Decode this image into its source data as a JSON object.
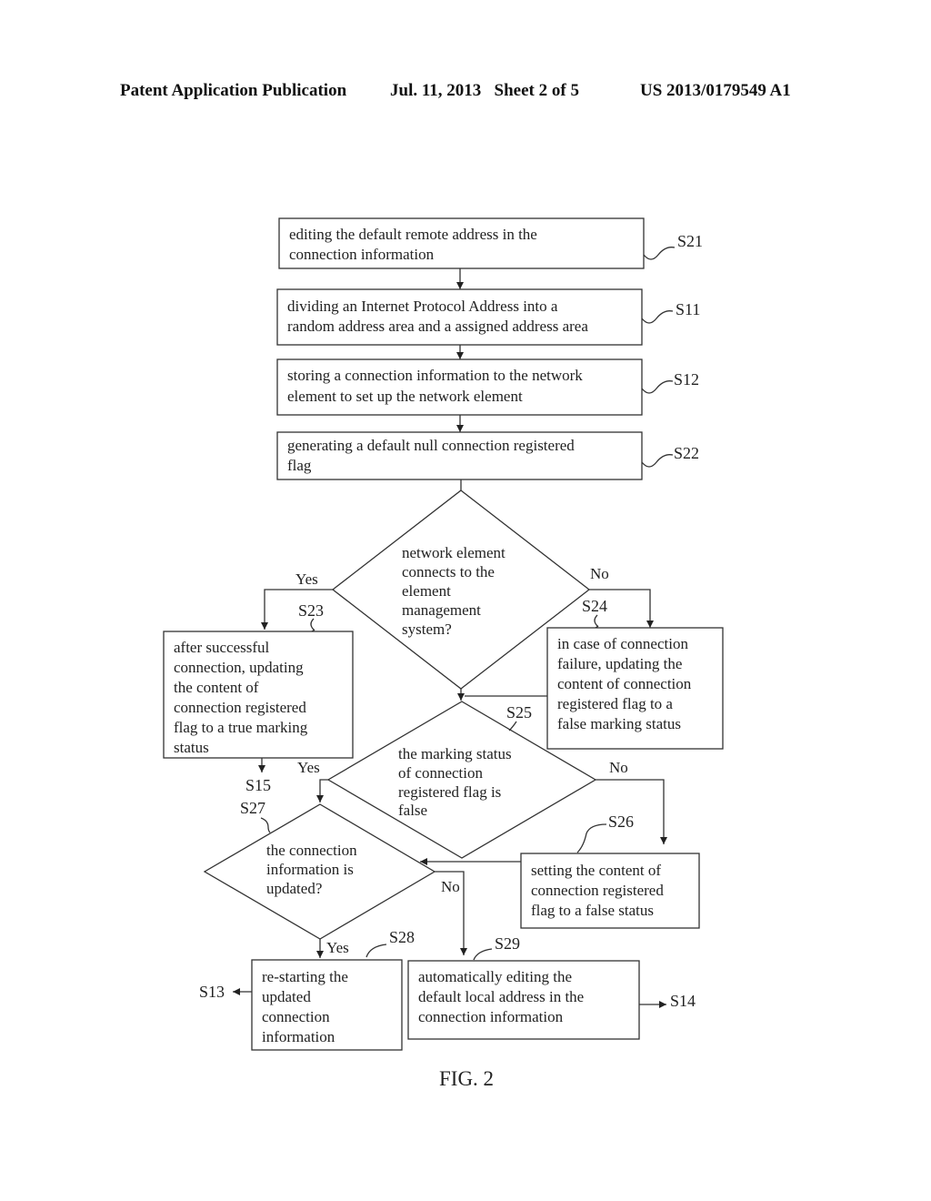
{
  "header": {
    "publication": "Patent Application Publication",
    "date_sheet": "Jul. 11, 2013   Sheet 2 of 5",
    "number": "US 2013/0179549 A1"
  },
  "figure_label": "FIG. 2",
  "steps": {
    "s21": {
      "ref": "S21",
      "lines": [
        "editing the default remote address in the",
        "connection information"
      ]
    },
    "s11": {
      "ref": "S11",
      "lines": [
        "dividing an Internet Protocol Address into a",
        "random address area and a assigned address area"
      ]
    },
    "s12": {
      "ref": "S12",
      "lines": [
        "storing a connection information to the network",
        "element to set up the network element"
      ]
    },
    "s22": {
      "ref": "S22",
      "lines": [
        "generating a default null connection registered",
        "flag"
      ]
    },
    "d1": {
      "lines": [
        "network element",
        "connects to the",
        "element",
        "management",
        "system?"
      ],
      "yes": "Yes",
      "no": "No"
    },
    "s23": {
      "ref": "S23",
      "lines": [
        "after successful",
        "connection, updating",
        "the content of",
        "connection registered",
        "flag to a true marking",
        "status"
      ]
    },
    "s24": {
      "ref": "S24",
      "lines": [
        "in case of connection",
        "failure, updating the",
        "content of connection",
        "registered flag to a",
        "false marking status"
      ]
    },
    "s25": {
      "ref": "S25",
      "lines": [
        "the marking status",
        "of connection",
        "registered flag is",
        "false"
      ],
      "yes": "Yes",
      "no": "No"
    },
    "s15": {
      "ref": "S15"
    },
    "s27": {
      "ref": "S27",
      "lines": [
        "the connection",
        "information is",
        "updated?"
      ],
      "yes": "Yes",
      "no": "No"
    },
    "s26": {
      "ref": "S26",
      "lines": [
        "setting the content of",
        "connection registered",
        "flag to a false status"
      ]
    },
    "s28": {
      "ref": "S28",
      "lines": [
        "re-starting the",
        "updated",
        "connection",
        "information"
      ]
    },
    "s29": {
      "ref": "S29",
      "lines": [
        "automatically editing the",
        "default local address in the",
        "connection information"
      ]
    },
    "s13": {
      "ref": "S13"
    },
    "s14": {
      "ref": "S14"
    }
  }
}
